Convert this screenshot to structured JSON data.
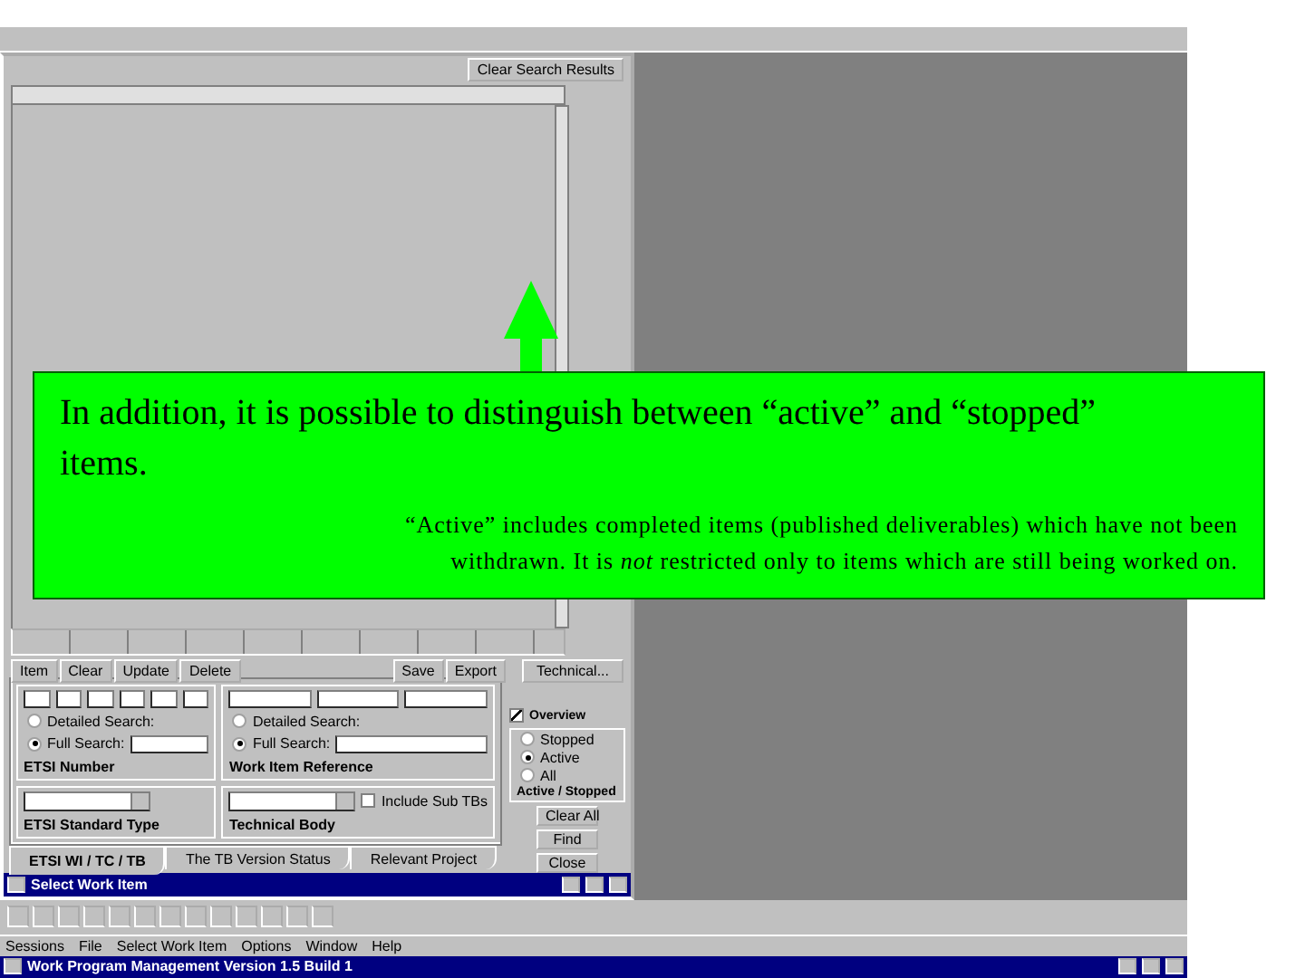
{
  "app": {
    "title": "Work Program Management Version 1.5 Build 1",
    "menu": [
      "Sessions",
      "File",
      "Select Work Item",
      "Options",
      "Window",
      "Help"
    ],
    "child_window": {
      "title": "Select Work Item",
      "tabs": [
        {
          "label": "ETSI WI / TC / TB",
          "selected": true
        },
        {
          "label": "The TB Version Status",
          "selected": false
        },
        {
          "label": "Relevant Project",
          "selected": false
        }
      ],
      "etsi_standard_type": {
        "label": "ETSI Standard Type"
      },
      "etsi_number": {
        "label": "ETSI Number",
        "options": [
          {
            "label": "Detailed Search:",
            "selected": false
          },
          {
            "label": "Full Search:",
            "selected": true
          }
        ]
      },
      "technical_body": {
        "label": "Technical Body",
        "checkbox_label": "Include Sub TBs",
        "checked": false
      },
      "work_item_reference": {
        "label": "Work Item Reference",
        "options": [
          {
            "label": "Detailed Search:",
            "selected": false
          },
          {
            "label": "Full Search:",
            "selected": true
          }
        ]
      },
      "overview": {
        "label": "Overview",
        "checked": true
      },
      "active_stopped": {
        "label": "Active / Stopped",
        "options": [
          {
            "label": "Stopped",
            "selected": false
          },
          {
            "label": "Active",
            "selected": true
          },
          {
            "label": "All",
            "selected": false
          }
        ]
      },
      "side_buttons": [
        "Clear All",
        "Find",
        "Close"
      ],
      "item_buttons": [
        "Item",
        "Clear",
        "Update",
        "Delete"
      ],
      "file_buttons": [
        "Save",
        "Export"
      ],
      "technical_button": "Technical...",
      "clear_results_button": "Clear Search Results"
    }
  },
  "callout": {
    "heading": "In addition, it is possible to distinguish between “active” and “stopped” items.",
    "body": "“Active” includes completed items (published deliverables) which have not been withdrawn. It is *not* restricted only to items which are still being worked on."
  }
}
